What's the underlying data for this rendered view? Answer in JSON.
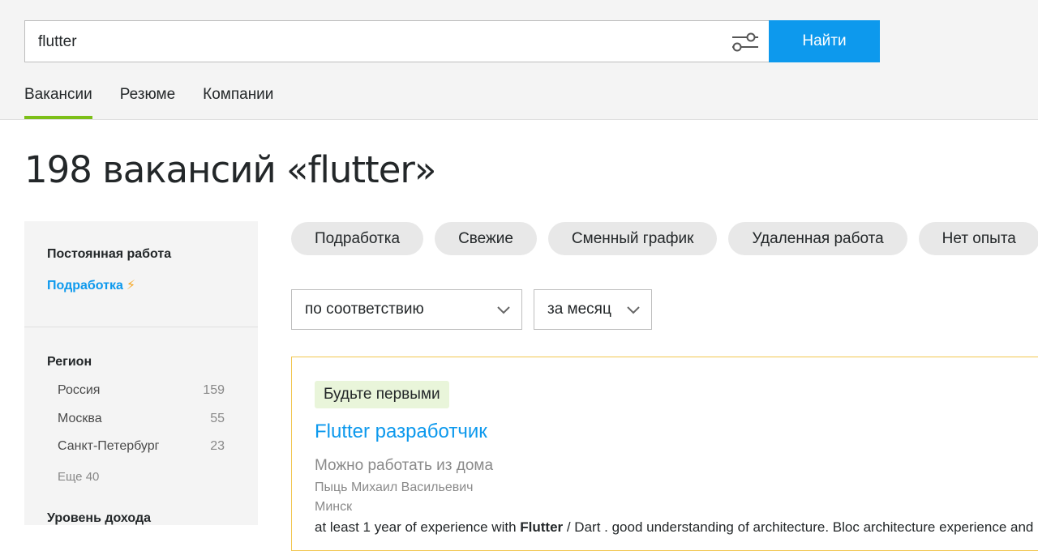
{
  "search": {
    "query": "flutter",
    "filter_icon": "filter-sliders-icon",
    "button_label": "Найти"
  },
  "tabs": [
    {
      "label": "Вакансии",
      "active": true
    },
    {
      "label": "Резюме",
      "active": false
    },
    {
      "label": "Компании",
      "active": false
    }
  ],
  "page_title": "198 вакансий «flutter»",
  "sidebar": {
    "employment": {
      "heading": "Постоянная работа",
      "link": "Подработка",
      "link_icon": "lightning-icon",
      "link_icon_color": "#f5a623"
    },
    "region": {
      "heading": "Регион",
      "items": [
        {
          "name": "Россия",
          "count": "159"
        },
        {
          "name": "Москва",
          "count": "55"
        },
        {
          "name": "Санкт-Петербург",
          "count": "23"
        }
      ],
      "more": "Еще 40"
    },
    "income_heading": "Уровень дохода"
  },
  "chips": [
    "Подработка",
    "Свежие",
    "Сменный график",
    "Удаленная работа",
    "Нет опыта"
  ],
  "sort": {
    "order": "по соответствию",
    "period": "за месяц"
  },
  "vacancy": {
    "badge": "Будьте первыми",
    "title": "Flutter разработчик",
    "remote": "Можно работать из дома",
    "company": "Пыць Михаил Васильевич",
    "city": "Минск",
    "snippet_start": "at least 1 year of experience with ",
    "snippet_bold": "Flutter",
    "snippet_end": " / Dart . good understanding of architecture. Bloc architecture experience and"
  },
  "colors": {
    "accent": "#0d99ed",
    "tab_underline": "#7cbf18",
    "card_border": "#f1c64f",
    "badge_bg": "#e9f5da"
  }
}
